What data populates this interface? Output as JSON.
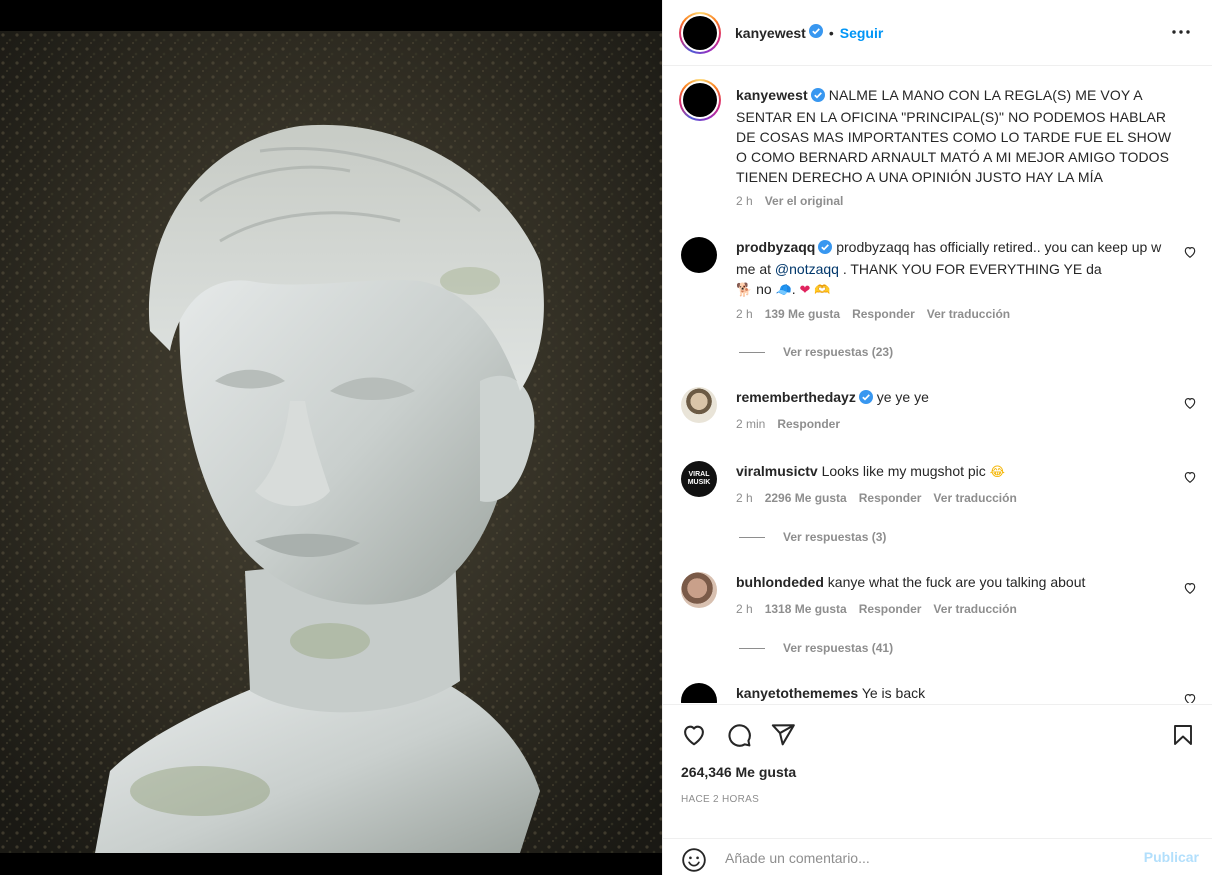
{
  "post": {
    "author": "kanyewest",
    "follow_label": "Seguir",
    "separator": "•",
    "caption": "NALME LA MANO CON LA REGLA(S) ME VOY A SENTAR EN LA OFICINA \"PRINCIPAL(S)\" NO PODEMOS HABLAR DE COSAS MAS IMPORTANTES COMO LO TARDE FUE EL SHOW O COMO BERNARD ARNAULT MATÓ A MI MEJOR AMIGO TODOS TIENEN DERECHO A UNA OPINIÓN JUSTO HAY LA MÍA",
    "caption_time": "2 h",
    "see_original": "Ver el original",
    "likes": "264,346 Me gusta",
    "time_ago": "HACE 2 HORAS"
  },
  "comments": [
    {
      "user": "prodbyzaqq",
      "text_before": "prodbyzaqq has officially retired.. you can keep up w me at ",
      "mention": "@notzaqq",
      "text_after": " . THANK YOU FOR EVERYTHING YE da",
      "text_line3": "no",
      "emoji_dog": "🐕",
      "emoji_cap": "🧢",
      "emoji_heart": "❤",
      "emoji_hands": "🫶",
      "time": "2 h",
      "likes": "139 Me gusta",
      "reply": "Responder",
      "translate": "Ver traducción",
      "replies": "Ver respuestas (23)"
    },
    {
      "user": "rememberthedayz",
      "text": "ye ye ye",
      "time": "2 min",
      "reply": "Responder"
    },
    {
      "user": "viralmusictv",
      "text": "Looks like my mugshot pic",
      "emoji": "😂",
      "avatar_text": "VIRAL MUSIK",
      "time": "2 h",
      "likes": "2296 Me gusta",
      "reply": "Responder",
      "translate": "Ver traducción",
      "replies": "Ver respuestas (3)"
    },
    {
      "user": "buhlondeded",
      "text": "kanye what the fuck are you talking about",
      "time": "2 h",
      "likes": "1318 Me gusta",
      "reply": "Responder",
      "translate": "Ver traducción",
      "replies": "Ver respuestas (41)"
    },
    {
      "user": "kanyetothememes",
      "text": "Ye is back"
    }
  ],
  "composer": {
    "placeholder": "Añade un comentario...",
    "publish_label": "Publicar"
  },
  "icons": {
    "verified": "verified-badge-icon",
    "more": "more-options-icon",
    "like": "heart-icon",
    "comment": "comment-icon",
    "share": "share-icon",
    "save": "bookmark-icon",
    "emoji": "emoji-icon"
  },
  "colors": {
    "accent": "#0095f6",
    "verified": "#3897f0",
    "muted": "#8e8e8e",
    "publish_disabled": "#b2dffc"
  }
}
